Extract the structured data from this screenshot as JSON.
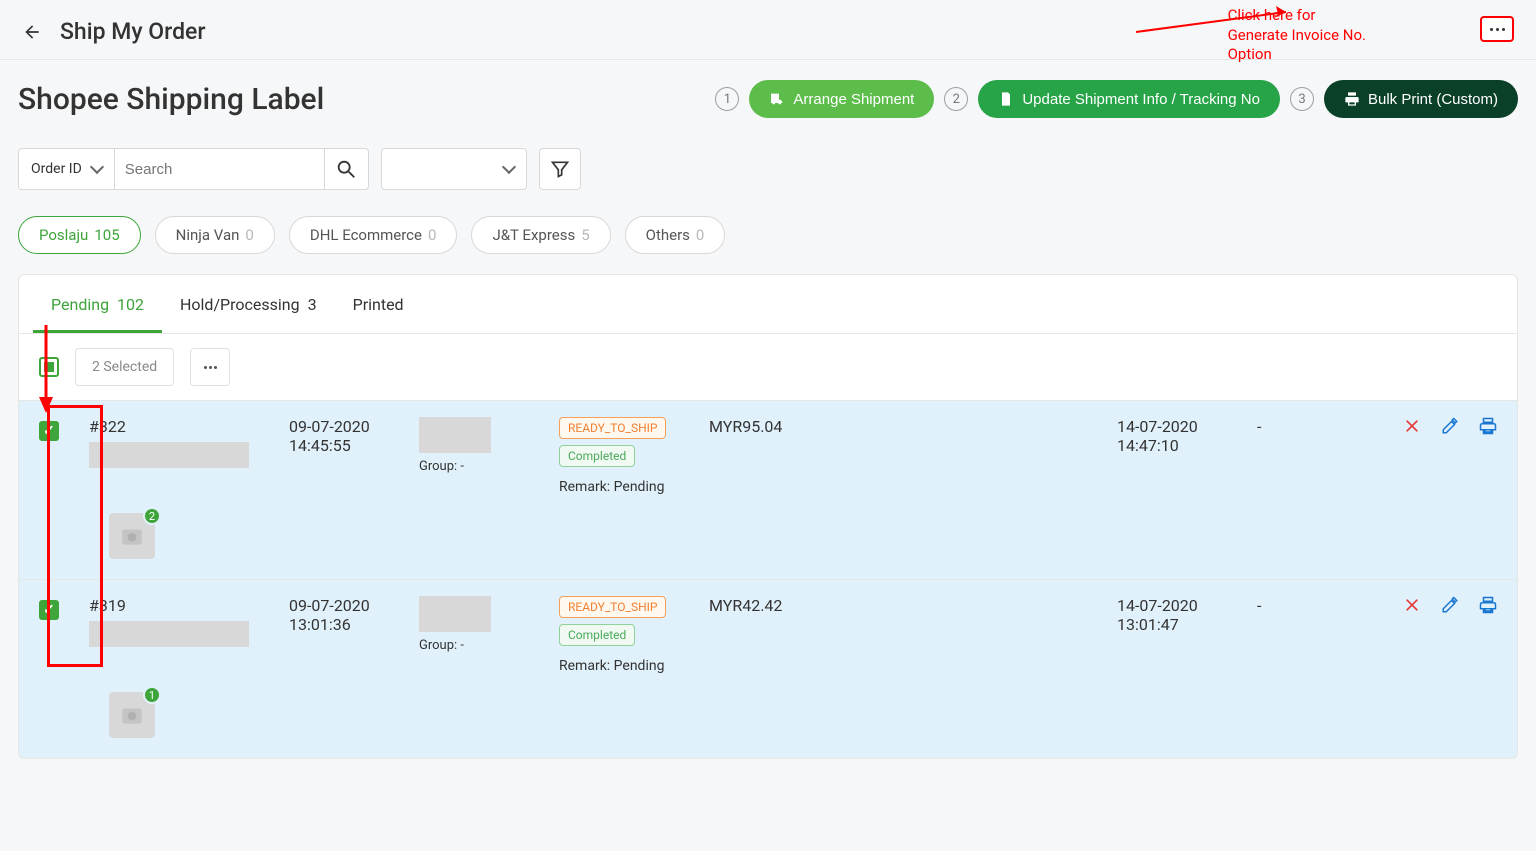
{
  "topbar": {
    "title": "Ship My Order"
  },
  "annotation": {
    "line1": "Click here for",
    "line2": "Generate Invoice No.",
    "line3": "Option"
  },
  "page": {
    "title": "Shopee Shipping Label"
  },
  "steps": {
    "s1": "1",
    "b1": "Arrange Shipment",
    "s2": "2",
    "b2": "Update Shipment Info / Tracking No",
    "s3": "3",
    "b3": "Bulk Print (Custom)"
  },
  "search": {
    "type": "Order ID",
    "placeholder": "Search"
  },
  "pills": [
    {
      "name": "Poslaju",
      "count": "105"
    },
    {
      "name": "Ninja Van",
      "count": "0"
    },
    {
      "name": "DHL Ecommerce",
      "count": "0"
    },
    {
      "name": "J&T Express",
      "count": "5"
    },
    {
      "name": "Others",
      "count": "0"
    }
  ],
  "tabs": [
    {
      "name": "Pending",
      "count": "102"
    },
    {
      "name": "Hold/Processing",
      "count": "3"
    },
    {
      "name": "Printed",
      "count": ""
    }
  ],
  "selected_label": "2 Selected",
  "rows": [
    {
      "id": "#322",
      "date": "09-07-2020",
      "time": "14:45:55",
      "group": "Group: -",
      "badge1": "READY_TO_SHIP",
      "badge2": "Completed",
      "remark": "Remark: Pending",
      "amount": "MYR95.04",
      "sched_date": "14-07-2020",
      "sched_time": "14:47:10",
      "dash": "-",
      "thumb_count": "2"
    },
    {
      "id": "#319",
      "date": "09-07-2020",
      "time": "13:01:36",
      "group": "Group: -",
      "badge1": "READY_TO_SHIP",
      "badge2": "Completed",
      "remark": "Remark: Pending",
      "amount": "MYR42.42",
      "sched_date": "14-07-2020",
      "sched_time": "13:01:47",
      "dash": "-",
      "thumb_count": "1"
    }
  ]
}
